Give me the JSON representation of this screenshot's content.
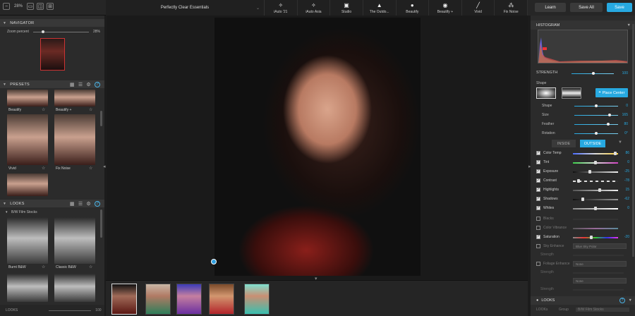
{
  "topbar": {
    "zoom": "28%",
    "preset_title": "Perfectly Clear Essentials",
    "presets": [
      {
        "label": "iAuto '21",
        "icon": "magic-wand-icon"
      },
      {
        "label": "iAuto Asia",
        "icon": "magic-wand-icon"
      },
      {
        "label": "Studio",
        "icon": "image-icon"
      },
      {
        "label": "The Outdo...",
        "icon": "image-icon"
      },
      {
        "label": "Beautify",
        "icon": "beautify-icon"
      },
      {
        "label": "Beautify +",
        "icon": "beautify-plus-icon"
      },
      {
        "label": "Vivid",
        "icon": "brush-icon"
      },
      {
        "label": "Fix Noise",
        "icon": "noise-icon"
      }
    ],
    "learn": "Learn",
    "save_all": "Save All",
    "save": "Save"
  },
  "navigator": {
    "title": "NAVIGATOR",
    "zoom_label": "Zoom percent",
    "zoom_value": "28%"
  },
  "presets_panel": {
    "title": "PRESETS",
    "items": [
      {
        "label": "Beautify"
      },
      {
        "label": "Beautify +"
      },
      {
        "label": "Vivid"
      },
      {
        "label": "Fix Noise"
      }
    ]
  },
  "looks_panel": {
    "title": "LOOKS",
    "group": "B/W Film Stocks",
    "items": [
      {
        "label": "Burnt B&W"
      },
      {
        "label": "Classic B&W"
      }
    ],
    "footer_label": "LOOKS",
    "footer_value": "100"
  },
  "right": {
    "histogram_title": "HISTOGRAM",
    "strength_label": "STRENGTH",
    "strength_value": "100",
    "shape_title": "Shape",
    "place_center": "Place Center",
    "params": [
      {
        "label": "Shape",
        "value": "0"
      },
      {
        "label": "Size",
        "value": "165"
      },
      {
        "label": "Feather",
        "value": "80"
      },
      {
        "label": "Rotation",
        "value": "0°"
      }
    ],
    "inside": "INSIDE",
    "outside": "OUTSIDE",
    "adjustments": [
      {
        "label": "Color Temp",
        "value": "86",
        "checked": true
      },
      {
        "label": "Tint",
        "value": "0",
        "checked": true
      },
      {
        "label": "Exposure",
        "value": "-25",
        "checked": true
      },
      {
        "label": "Contrast",
        "value": "-78",
        "checked": true
      },
      {
        "label": "Highlights",
        "value": "15",
        "checked": true
      },
      {
        "label": "Shadows",
        "value": "-62",
        "checked": true
      },
      {
        "label": "Whites",
        "value": "0",
        "checked": true
      },
      {
        "label": "Blacks",
        "value": "",
        "checked": false
      },
      {
        "label": "Color Vibrance",
        "value": "",
        "checked": false
      },
      {
        "label": "Saturation",
        "value": "-20",
        "checked": true
      }
    ],
    "sky_enhance": "Sky Enhance",
    "sky_dropdown": "Blue Sky Polar",
    "strength_a": "Strength",
    "foliage_enhance": "Foliage Enhance",
    "foliage_dropdown": "None",
    "strength_b": "Strength",
    "dropdown_c": "None",
    "strength_c": "Strength",
    "looks_title": "LOOKS",
    "looks_sub": "LOOKs",
    "looks_group_label": "Group",
    "looks_group_value": "B/W Film Stocks"
  }
}
